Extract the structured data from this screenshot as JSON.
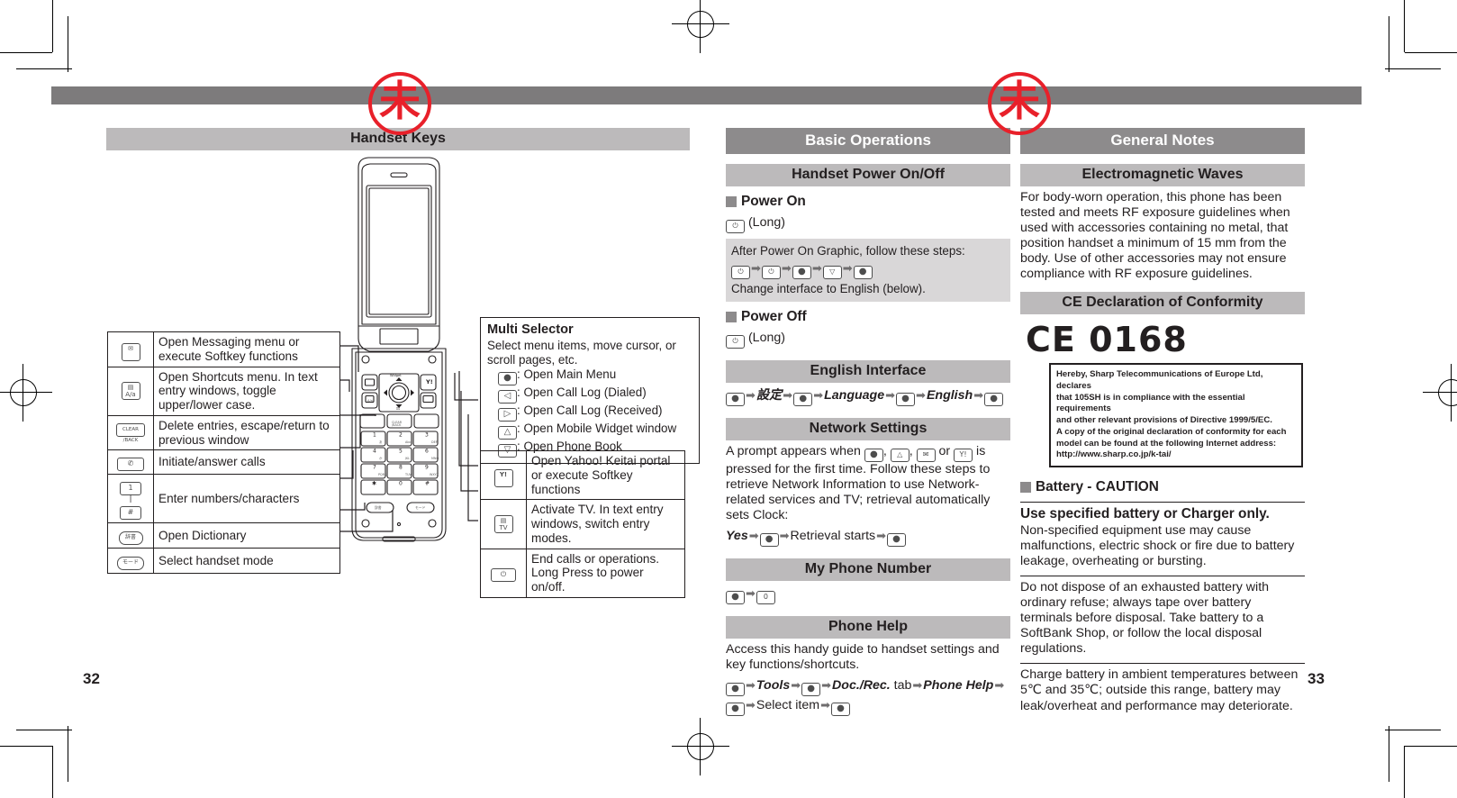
{
  "print_marks": {
    "stamp_glyph": "未",
    "stamp_color": "#e8202a"
  },
  "pages": {
    "left_number": "32",
    "right_number": "33"
  },
  "left_page": {
    "title": "Handset Keys",
    "key_table": [
      {
        "icon": "envelope-key-icon",
        "glyph": "✉",
        "desc": "Open Messaging menu or execute Softkey functions"
      },
      {
        "icon": "shortcuts-key-icon",
        "glyph": "A/a",
        "desc": "Open Shortcuts menu. In text entry windows, toggle upper/lower case."
      },
      {
        "icon": "clear-back-key-icon",
        "glyph": "CLEAR",
        "desc": "Delete entries, escape/return to previous window"
      },
      {
        "icon": "call-key-icon",
        "glyph": "✆",
        "desc": "Initiate/answer calls"
      },
      {
        "icon": "number-keys-icon",
        "glyph": "1 — #",
        "desc": "Enter numbers/characters"
      },
      {
        "icon": "dictionary-key-icon",
        "glyph": "辞書",
        "desc": "Open Dictionary"
      },
      {
        "icon": "handset-mode-key-icon",
        "glyph": "モード",
        "desc": "Select handset mode"
      }
    ],
    "multi_selector": {
      "title": "Multi Selector",
      "desc": "Select menu items, move cursor, or scroll pages, etc.",
      "items": [
        {
          "glyph": "●",
          "label": ": Open Main Menu"
        },
        {
          "glyph": "◁",
          "label": ": Open Call Log (Dialed)"
        },
        {
          "glyph": "▷",
          "label": ": Open Call Log (Received)"
        },
        {
          "glyph": "△",
          "label": ": Open Mobile Widget window"
        },
        {
          "glyph": "▽",
          "label": ": Open Phone Book"
        }
      ]
    },
    "right_table": [
      {
        "icon": "yahoo-keitai-key-icon",
        "glyph": "Y!",
        "desc": "Open Yahoo! Keitai portal or execute Softkey functions"
      },
      {
        "icon": "tv-key-icon",
        "glyph": "TV",
        "desc": "Activate TV. In text entry windows, switch entry modes."
      },
      {
        "icon": "power-end-key-icon",
        "glyph": "⏻",
        "desc": "End calls or operations. Long Press to power on/off."
      }
    ]
  },
  "middle_page": {
    "title": "Basic Operations",
    "sections": [
      {
        "heading": "Handset Power On/Off",
        "power_on_label": "Power On",
        "power_on_step": "(Long)",
        "note_line1": "After Power On Graphic, follow these steps:",
        "note_keys": [
          "⏻",
          "⏻",
          "●",
          "▽",
          "●"
        ],
        "note_line2": "Change interface to English (below).",
        "power_off_label": "Power Off",
        "power_off_step": "(Long)"
      },
      {
        "heading": "English Interface",
        "steps_text": "● ➡ 設定 ➡ ● ➡ Language ➡ ● ➡ English ➡ ●",
        "step_tokens": [
          "●",
          "設定",
          "●",
          "Language",
          "●",
          "English",
          "●"
        ]
      },
      {
        "heading": "Network Settings",
        "body": "A prompt appears when ●, △, ✉ or Y! is pressed for the first time. Follow these steps to retrieve Network Information to use Network-related services and TV; retrieval automatically sets Clock:",
        "body_part1": "A prompt appears when",
        "body_part2": "is pressed for the first time. Follow these steps to retrieve Network Information to use Network-related services and TV; retrieval automatically sets Clock:",
        "steps_yes": "Yes",
        "steps_retrieval": "Retrieval starts"
      },
      {
        "heading": "My Phone Number",
        "step_keys": [
          "●",
          "0"
        ]
      },
      {
        "heading": "Phone Help",
        "body": "Access this handy guide to handset settings and key functions/shortcuts.",
        "step_tools": "Tools",
        "step_docrec": "Doc./Rec.",
        "step_tab": "tab",
        "step_phonehelp": "Phone Help",
        "step_select": "Select item"
      }
    ]
  },
  "right_page": {
    "title": "General Notes",
    "electromagnetic": {
      "heading": "Electromagnetic Waves",
      "body": "For body-worn operation, this phone has been tested and meets RF exposure guidelines when used with accessories containing no metal, that position handset a minimum of 15 mm from the body. Use of other accessories may not ensure compliance with RF exposure guidelines."
    },
    "ce": {
      "heading": "CE Declaration of Conformity",
      "mark": "CE 0168",
      "declaration_lines": [
        "Hereby, Sharp Telecommunications of Europe Ltd, declares",
        "that 105SH is in compliance with the essential requirements",
        "and other relevant provisions of Directive 1999/5/EC.",
        "A copy of the original declaration of conformity for each",
        "model can be found at the following Internet address:",
        "http://www.sharp.co.jp/k-tai/"
      ]
    },
    "battery": {
      "heading": "Battery - CAUTION",
      "warn_bold": "Use specified battery or Charger only.",
      "warn_body": "Non-specified equipment use may cause malfunctions, electric shock or fire due to battery leakage, overheating or bursting.",
      "note1": "Do not dispose of an exhausted battery with ordinary refuse; always tape over battery terminals before disposal. Take battery to a SoftBank Shop, or follow the local disposal regulations.",
      "note2": "Charge battery in ambient temperatures between 5℃ and 35℃; outside this range, battery may leak/overheat and performance may deteriorate."
    }
  }
}
